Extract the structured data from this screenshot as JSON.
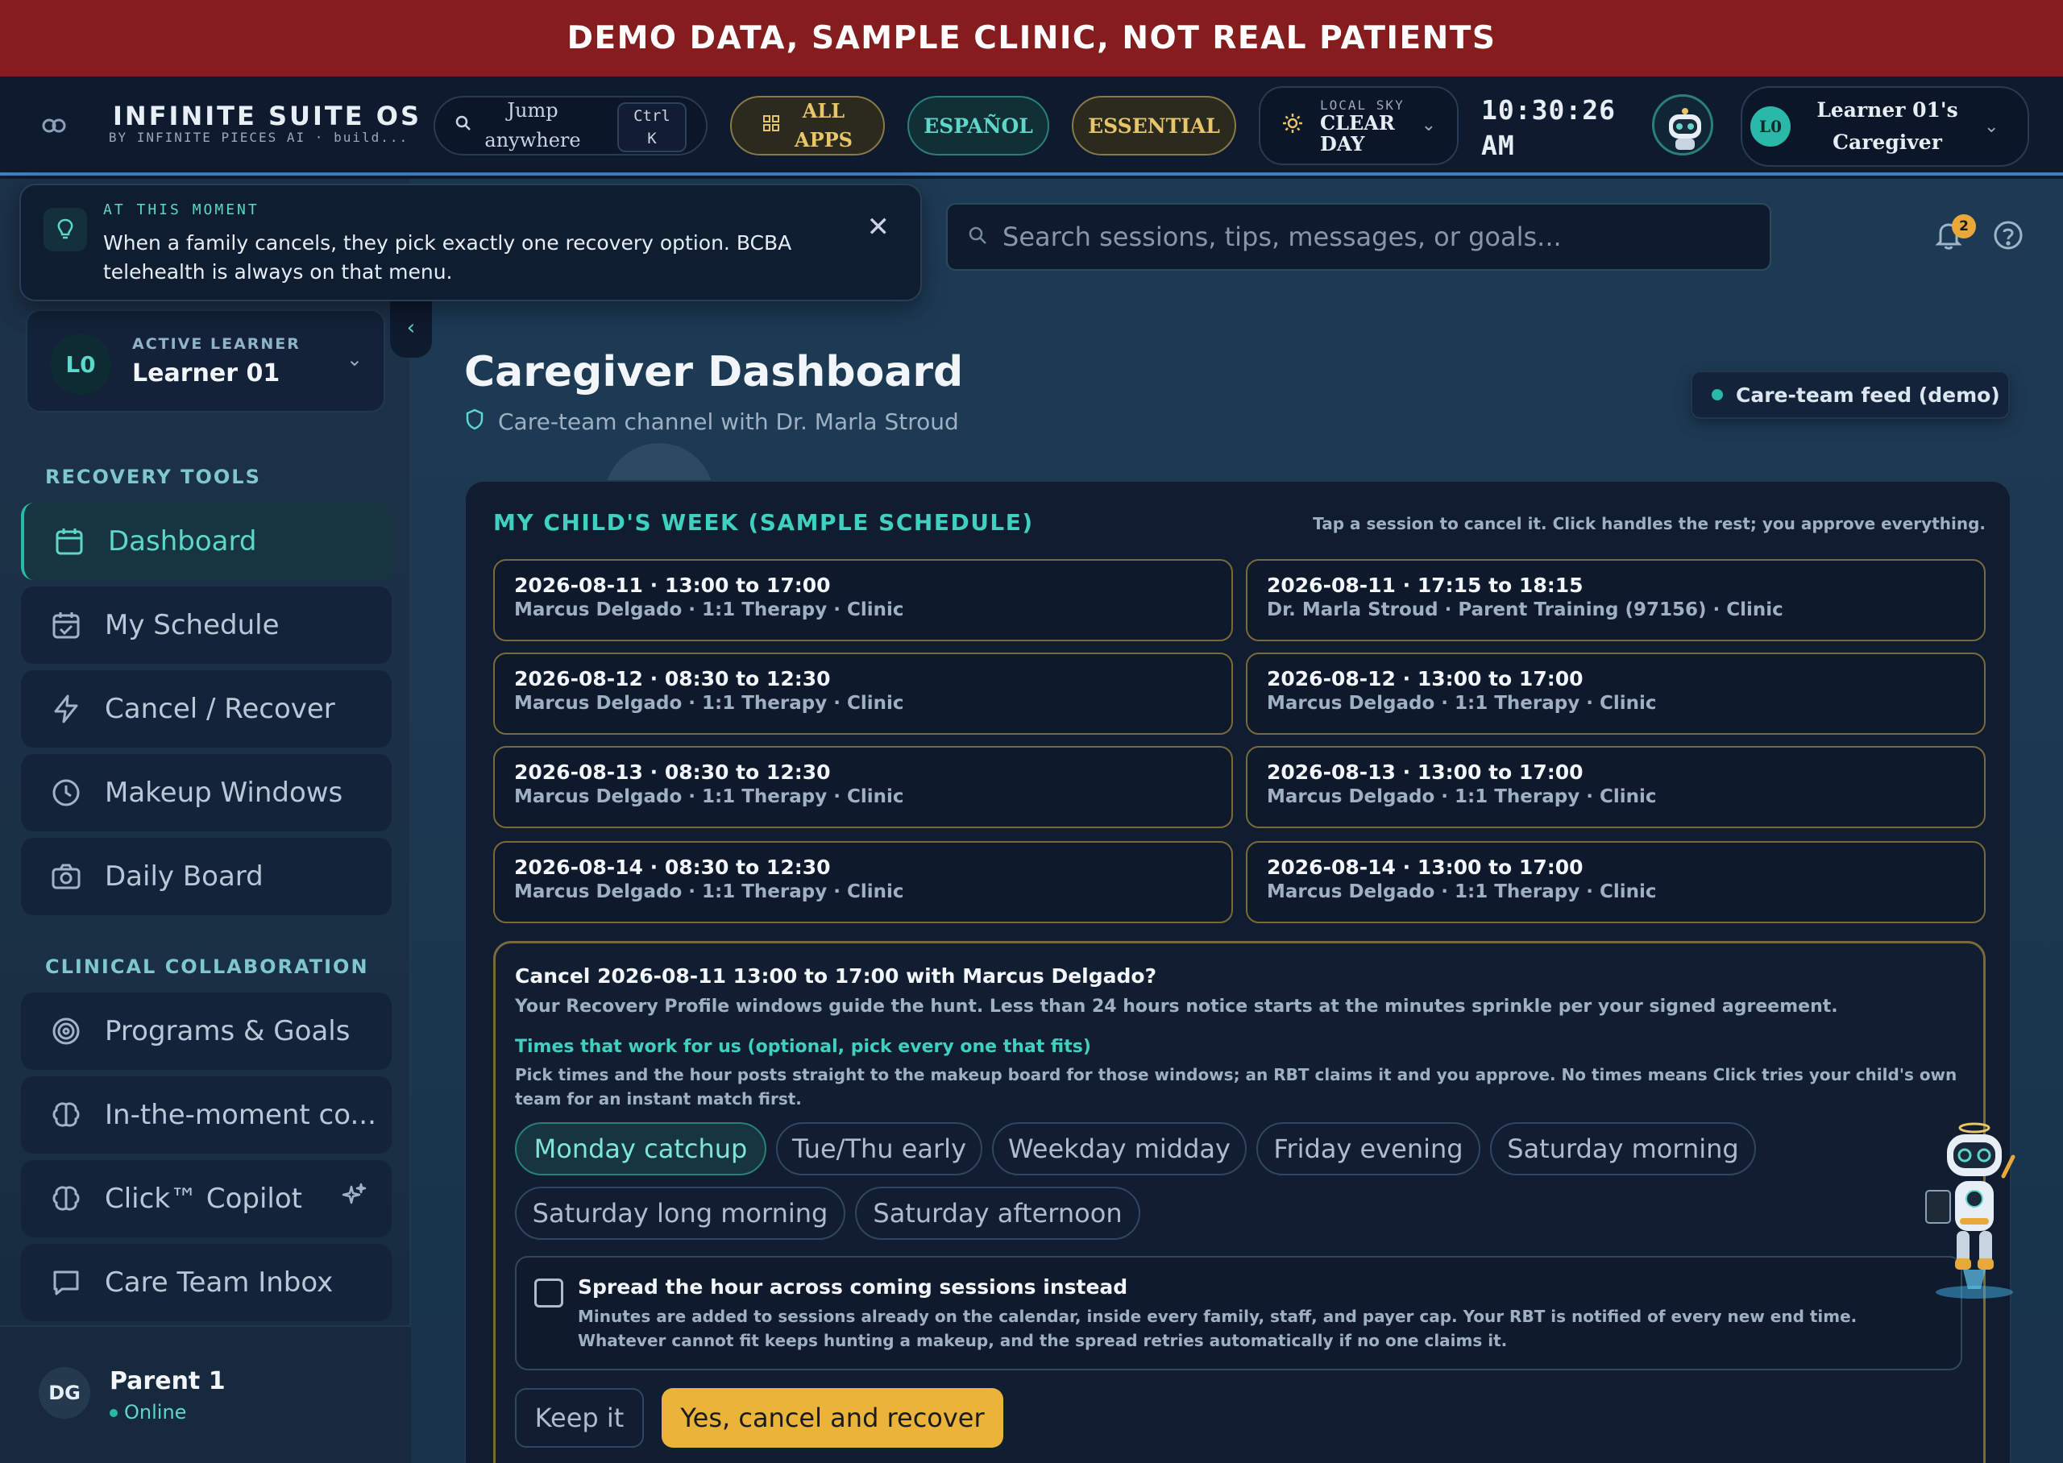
{
  "banner": "DEMO DATA, SAMPLE CLINIC, NOT REAL PATIENTS",
  "topbar": {
    "brand_title": "INFINITE SUITE OS",
    "brand_sub": "BY INFINITE PIECES AI · build...",
    "jump_line1": "Jump",
    "jump_line2": "anywhere",
    "kbd_line1": "Ctrl",
    "kbd_line2": "K",
    "all_apps_line1": "ALL",
    "all_apps_line2": "APPS",
    "espanol": "ESPAÑOL",
    "essential": "ESSENTIAL",
    "sky_caption": "LOCAL SKY",
    "sky_line1": "CLEAR",
    "sky_line2": "DAY",
    "clock_time": "10:30:26",
    "clock_ampm": "AM",
    "caregiver_initials": "L0",
    "caregiver_line1": "Learner 01's",
    "caregiver_line2": "Caregiver"
  },
  "tip": {
    "caption": "AT THIS MOMENT",
    "message": "When a family cancels, they pick exactly one recovery option. BCBA telehealth is always on that menu."
  },
  "search": {
    "placeholder": "Search sessions, tips, messages, or goals..."
  },
  "notifications": {
    "count": "2"
  },
  "sidebar": {
    "learner_initials": "L0",
    "learner_caption": "ACTIVE LEARNER",
    "learner_name": "Learner 01",
    "section1": "RECOVERY TOOLS",
    "section2": "CLINICAL COLLABORATION",
    "items": [
      {
        "label": "Dashboard",
        "icon": "calendar-icon"
      },
      {
        "label": "My Schedule",
        "icon": "calendar-check-icon"
      },
      {
        "label": "Cancel / Recover",
        "icon": "lightning-icon"
      },
      {
        "label": "Makeup Windows",
        "icon": "clock-icon"
      },
      {
        "label": "Daily Board",
        "icon": "camera-icon"
      },
      {
        "label": "Programs & Goals",
        "icon": "target-icon"
      },
      {
        "label": "In-the-moment co...",
        "icon": "brain-icon"
      },
      {
        "label": "Click™ Copilot",
        "icon": "brain-icon"
      },
      {
        "label": "Care Team Inbox",
        "icon": "chat-icon"
      }
    ],
    "user_initials": "DG",
    "user_name": "Parent 1",
    "user_status": "Online"
  },
  "header": {
    "title": "Caregiver Dashboard",
    "subtitle": "Care-team channel with Dr. Marla Stroud",
    "feed_button": "Care-team feed (demo)"
  },
  "week": {
    "title": "MY CHILD'S WEEK (SAMPLE SCHEDULE)",
    "hint": "Tap a session to cancel it. Click handles the rest; you approve everything.",
    "sessions": [
      {
        "datetime": "2026-08-11 · 13:00 to 17:00",
        "detail": "Marcus Delgado · 1:1 Therapy · Clinic"
      },
      {
        "datetime": "2026-08-11 · 17:15 to 18:15",
        "detail": "Dr. Marla Stroud · Parent Training (97156) · Clinic"
      },
      {
        "datetime": "2026-08-12 · 08:30 to 12:30",
        "detail": "Marcus Delgado · 1:1 Therapy · Clinic"
      },
      {
        "datetime": "2026-08-12 · 13:00 to 17:00",
        "detail": "Marcus Delgado · 1:1 Therapy · Clinic"
      },
      {
        "datetime": "2026-08-13 · 08:30 to 12:30",
        "detail": "Marcus Delgado · 1:1 Therapy · Clinic"
      },
      {
        "datetime": "2026-08-13 · 13:00 to 17:00",
        "detail": "Marcus Delgado · 1:1 Therapy · Clinic"
      },
      {
        "datetime": "2026-08-14 · 08:30 to 12:30",
        "detail": "Marcus Delgado · 1:1 Therapy · Clinic"
      },
      {
        "datetime": "2026-08-14 · 13:00 to 17:00",
        "detail": "Marcus Delgado · 1:1 Therapy · Clinic"
      }
    ]
  },
  "cancel": {
    "question": "Cancel 2026-08-11 13:00 to 17:00 with Marcus Delgado?",
    "desc1": "Your Recovery Profile windows guide the hunt. Less than 24 hours notice starts at the minutes sprinkle per your signed agreement.",
    "times_label": "Times that work for us (optional, pick every one that fits)",
    "desc2": "Pick times and the hour posts straight to the makeup board for those windows; an RBT claims it and you approve. No times means Click tries your child's own team for an instant match first.",
    "chips": [
      {
        "label": "Monday catchup",
        "selected": true
      },
      {
        "label": "Tue/Thu early",
        "selected": false
      },
      {
        "label": "Weekday midday",
        "selected": false
      },
      {
        "label": "Friday evening",
        "selected": false
      },
      {
        "label": "Saturday morning",
        "selected": false
      },
      {
        "label": "Saturday long morning",
        "selected": false
      },
      {
        "label": "Saturday afternoon",
        "selected": false
      }
    ],
    "spread_title": "Spread the hour across coming sessions instead",
    "spread_desc": "Minutes are added to sessions already on the calendar, inside every family, staff, and payer cap. Your RBT is notified of every new end time. Whatever cannot fit keeps hunting a makeup, and the spread retries automatically if no one claims it.",
    "keep_label": "Keep it",
    "confirm_label": "Yes, cancel and recover"
  },
  "colors": {
    "accent_teal": "#2ab8a8",
    "accent_gold": "#eab33a",
    "banner_red": "#851d1f"
  }
}
